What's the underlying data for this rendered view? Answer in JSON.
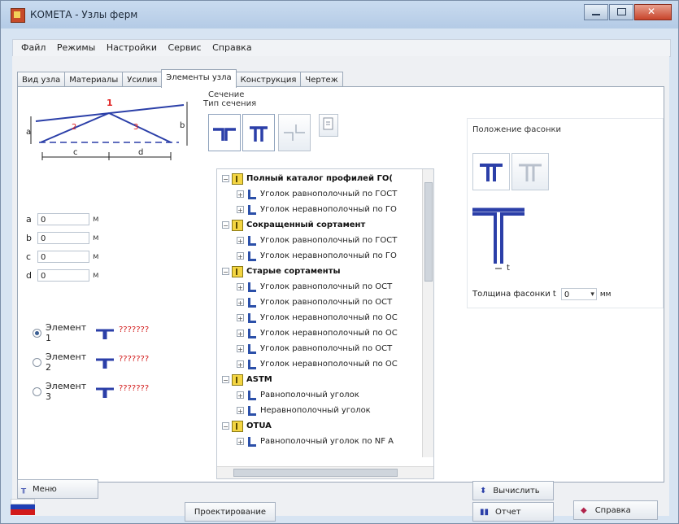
{
  "window": {
    "title": "КОМЕТА - Узлы ферм"
  },
  "menu": [
    "Файл",
    "Режимы",
    "Настройки",
    "Сервис",
    "Справка"
  ],
  "tabs": [
    {
      "label": "Вид узла",
      "active": false
    },
    {
      "label": "Материалы",
      "active": false
    },
    {
      "label": "Усилия",
      "active": false
    },
    {
      "label": "Элементы узла",
      "active": true
    },
    {
      "label": "Конструкция",
      "active": false
    },
    {
      "label": "Чертеж",
      "active": false
    }
  ],
  "diagram": {
    "labels": {
      "n1": "1",
      "n2": "2",
      "n3": "3",
      "a": "a",
      "b": "b",
      "c": "c",
      "d": "d"
    }
  },
  "dims": [
    {
      "name": "a",
      "value": "0",
      "unit": "м"
    },
    {
      "name": "b",
      "value": "0",
      "unit": "м"
    },
    {
      "name": "c",
      "value": "0",
      "unit": "м"
    },
    {
      "name": "d",
      "value": "0",
      "unit": "м"
    }
  ],
  "elements": [
    {
      "label": "Элемент 1",
      "status": "???????",
      "selected": true
    },
    {
      "label": "Элемент 2",
      "status": "???????",
      "selected": false
    },
    {
      "label": "Элемент 3",
      "status": "???????",
      "selected": false
    }
  ],
  "section": {
    "heading": "Сечение",
    "type_heading": "Тип сечения"
  },
  "catalog": [
    {
      "kind": "cat",
      "text": "Полный каталог профилей ГО("
    },
    {
      "kind": "item",
      "text": "Уголок равнополочный по ГОСТ"
    },
    {
      "kind": "item",
      "text": "Уголок неравнополочный по ГО"
    },
    {
      "kind": "cat",
      "text": "Сокращенный сортамент"
    },
    {
      "kind": "item",
      "text": "Уголок равнополочный по ГОСТ"
    },
    {
      "kind": "item",
      "text": "Уголок неравнополочный по ГО"
    },
    {
      "kind": "cat",
      "text": "Старые сортаменты"
    },
    {
      "kind": "item",
      "text": "Уголок равнополочный по ОСТ"
    },
    {
      "kind": "item",
      "text": "Уголок равнополочный по ОСТ"
    },
    {
      "kind": "item",
      "text": "Уголок неравнополочный по ОС"
    },
    {
      "kind": "item",
      "text": "Уголок неравнополочный по ОС"
    },
    {
      "kind": "item",
      "text": "Уголок равнополочный по ОСТ"
    },
    {
      "kind": "item",
      "text": "Уголок неравнополочный по ОС"
    },
    {
      "kind": "cat",
      "text": "ASTM"
    },
    {
      "kind": "item",
      "text": "Равнополочный уголок"
    },
    {
      "kind": "item",
      "text": "Неравнополочный уголок"
    },
    {
      "kind": "cat",
      "text": "OTUA"
    },
    {
      "kind": "item",
      "text": "Равнополочный уголок по NF A"
    }
  ],
  "gusset": {
    "position_label": "Положение фасонки",
    "thickness_label": "Толщина фасонки t",
    "thickness_value": "0",
    "thickness_unit": "мм",
    "t_label": "t"
  },
  "buttons": {
    "menu": "Меню",
    "design": "Проектирование",
    "calc": "Вычислить",
    "report": "Отчет",
    "help": "Справка"
  },
  "colors": {
    "accent_blue": "#2b3fa8",
    "diagram_red": "#e02020",
    "status_red": "#d21a1a",
    "flag_white": "#ffffff",
    "flag_blue": "#1f3fb5",
    "flag_red": "#d21a1a"
  }
}
